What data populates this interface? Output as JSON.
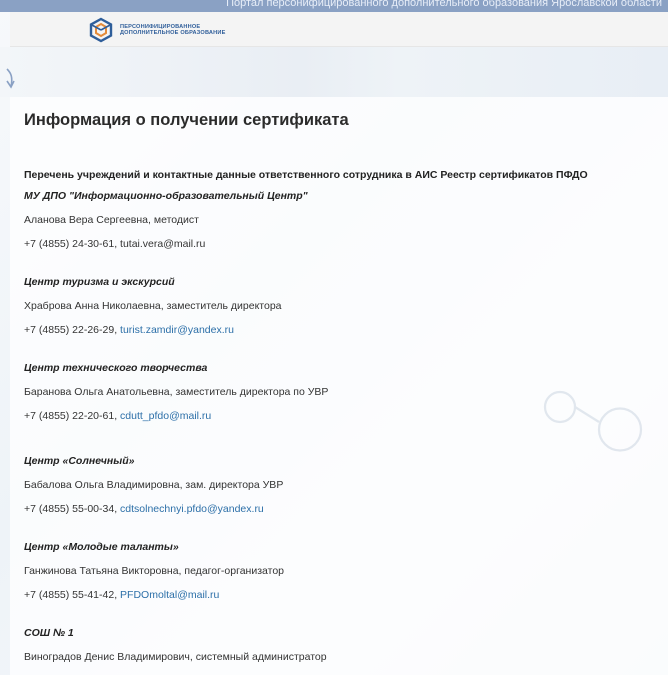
{
  "header": {
    "tagline": "Портал персонифицированного дополнительного образования Ярославской области",
    "logo_text": "ПЕРСОНИФИЦИРОВАННОЕ ДОПОЛНИТЕЛЬНОЕ ОБРАЗОВАНИЕ"
  },
  "page": {
    "title": "Информация о получении сертификата",
    "intro": "Перечень учреждений и контактные данные ответственного сотрудника в АИС Реестр сертификатов ПФДО"
  },
  "entries": [
    {
      "org": "МУ ДПО \"Информационно-образовательный Центр\"",
      "person": "Аланова Вера Сергеевна, методист",
      "phone": "+7 (4855) 24-30-61, tutai.vera@mail.ru",
      "email": ""
    },
    {
      "org": "Центр туризма и экскурсий",
      "person": "Храброва Анна Николаевна, заместитель директора",
      "phone": "+7 (4855) 22-26-29, ",
      "email": "turist.zamdir@yandex.ru"
    },
    {
      "org": "Центр технического творчества",
      "person": "Баранова Ольга Анатольевна, заместитель директора по УВР",
      "phone": "+7 (4855) 22-20-61, ",
      "email": "cdutt_pfdo@mail.ru"
    },
    {
      "org": "Центр «Солнечный»",
      "person": "Бабалова Ольга Владимировна, зам. директора УВР",
      "phone": "+7 (4855) 55-00-34, ",
      "email": "cdtsolnechnyi.pfdo@yandex.ru"
    },
    {
      "org": "Центр «Молодые таланты»",
      "person": "Ганжинова Татьяна Викторовна, педагог-организатор",
      "phone": "+7 (4855) 55-41-42, ",
      "email": "PFDOmoltal@mail.ru"
    },
    {
      "org": "СОШ № 1",
      "person": "Виноградов Денис Владимирович, системный администратор",
      "phone": "",
      "email": ""
    }
  ],
  "colors": {
    "link": "#2c6fa8",
    "header_bar": "#8aa1c4",
    "logo_blue": "#2f5e9a"
  },
  "icons": {
    "logo": "pfdo-logo-icon",
    "banner": "banner-leaf-icon"
  }
}
